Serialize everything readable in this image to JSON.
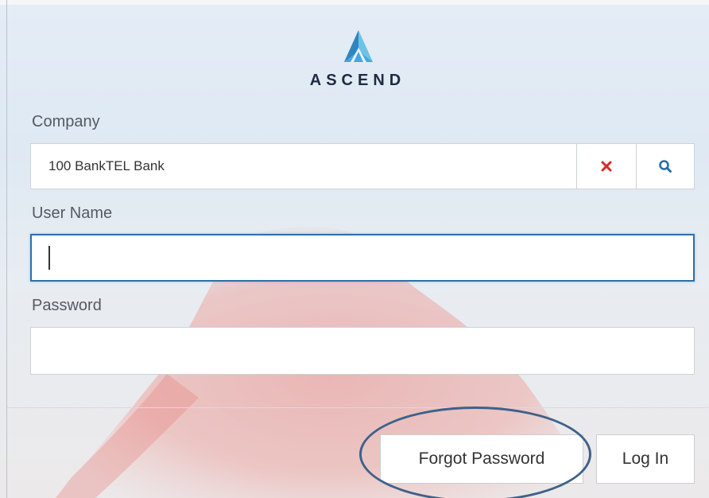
{
  "brand": {
    "name": "ASCEND",
    "logo_colors": {
      "dark": "#3a8cc6",
      "light": "#6ec3e4"
    }
  },
  "company": {
    "label": "Company",
    "value": "100 BankTEL Bank",
    "clear_icon": "clear-icon",
    "search_icon": "search-icon"
  },
  "username": {
    "label": "User Name",
    "value": ""
  },
  "password": {
    "label": "Password",
    "value": ""
  },
  "buttons": {
    "forgot_password": "Forgot Password",
    "log_in": "Log In"
  },
  "colors": {
    "focus_border": "#2f6fa8",
    "clear_icon": "#d62b2b",
    "search_icon": "#2a6fa5",
    "highlight_ring": "#3e6189"
  }
}
